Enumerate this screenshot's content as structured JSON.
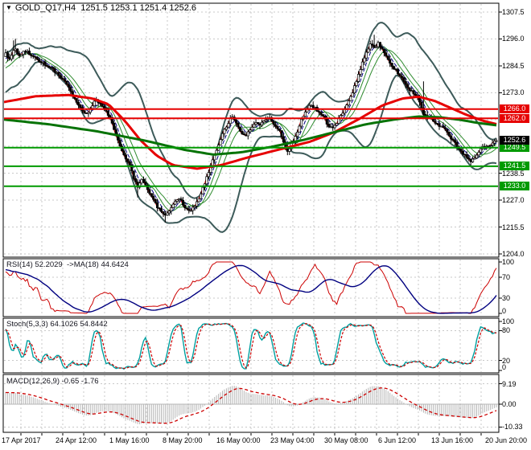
{
  "title": {
    "dropdown_icon": "▼",
    "symbol_timeframe": "GOLD_Q17,H4",
    "quote_line": "1251.5 1253.1 1251.4 1252.6"
  },
  "chart_data": {
    "type": "candlestick",
    "symbol": "GOLD_Q17",
    "timeframe": "H4",
    "ohlc": {
      "open": 1251.5,
      "high": 1253.1,
      "low": 1251.4,
      "close": 1252.6
    },
    "price_axis": {
      "min": 1204.0,
      "max": 1307.5,
      "ticks": [
        {
          "v": 1307.5,
          "label": "1307.5"
        },
        {
          "v": 1296.0,
          "label": "1296.0"
        },
        {
          "v": 1284.5,
          "label": "1284.5"
        },
        {
          "v": 1273.0,
          "label": "1273.0"
        },
        {
          "v": 1261.5,
          "label": ""
        },
        {
          "v": 1250.0,
          "label": ""
        },
        {
          "v": 1238.5,
          "label": "1238.5"
        },
        {
          "v": 1227.0,
          "label": "1227.0"
        },
        {
          "v": 1215.5,
          "label": "1215.5"
        },
        {
          "v": 1204.0,
          "label": "1204.0"
        }
      ]
    },
    "time_labels": [
      "17 Apr 2017",
      "24 Apr 12:00",
      "1 May 16:00",
      "8 May 20:00",
      "16 May 00:00",
      "23 May 04:00",
      "30 May 08:00",
      "6 Jun 12:00",
      "13 Jun 16:00",
      "20 Jun 20:00"
    ],
    "levels": [
      {
        "price": 1266.0,
        "label": "1266.0",
        "kind": "resistance"
      },
      {
        "price": 1262.0,
        "label": "1262.0",
        "kind": "resistance"
      },
      {
        "price": 1249.5,
        "label": "1249.5",
        "kind": "support"
      },
      {
        "price": 1241.5,
        "label": "1241.5",
        "kind": "support"
      },
      {
        "price": 1233.0,
        "label": "1233.0",
        "kind": "support"
      }
    ],
    "current": {
      "price": 1252.6,
      "label": "1252.6"
    },
    "close_path": [
      [
        6,
        1290
      ],
      [
        12,
        1287
      ],
      [
        18,
        1292
      ],
      [
        24,
        1289
      ],
      [
        32,
        1291
      ],
      [
        42,
        1288
      ],
      [
        52,
        1286
      ],
      [
        62,
        1284
      ],
      [
        72,
        1281
      ],
      [
        82,
        1277.5
      ],
      [
        92,
        1271
      ],
      [
        100,
        1267
      ],
      [
        106,
        1263.5
      ],
      [
        112,
        1266
      ],
      [
        119,
        1270.5
      ],
      [
        125,
        1268
      ],
      [
        131,
        1266
      ],
      [
        137,
        1262
      ],
      [
        143,
        1256
      ],
      [
        149,
        1250.5
      ],
      [
        155,
        1246
      ],
      [
        161,
        1242
      ],
      [
        167,
        1236
      ],
      [
        171,
        1232.5
      ],
      [
        176,
        1236.5
      ],
      [
        181,
        1233
      ],
      [
        187,
        1229
      ],
      [
        193,
        1225.5
      ],
      [
        199,
        1222.5
      ],
      [
        205,
        1220.5
      ],
      [
        211,
        1222.5
      ],
      [
        217,
        1226
      ],
      [
        223,
        1227.5
      ],
      [
        229,
        1224.5
      ],
      [
        235,
        1222
      ],
      [
        241,
        1224
      ],
      [
        247,
        1228
      ],
      [
        253,
        1233
      ],
      [
        259,
        1239
      ],
      [
        265,
        1245
      ],
      [
        271,
        1250.5
      ],
      [
        277,
        1255.5
      ],
      [
        283,
        1259.5
      ],
      [
        288,
        1263
      ],
      [
        293,
        1260
      ],
      [
        299,
        1256.5
      ],
      [
        305,
        1254
      ],
      [
        311,
        1257.5
      ],
      [
        317,
        1260.5
      ],
      [
        323,
        1259.5
      ],
      [
        329,
        1261
      ],
      [
        335,
        1262
      ],
      [
        341,
        1259.5
      ],
      [
        347,
        1257
      ],
      [
        353,
        1251
      ],
      [
        357,
        1247.5
      ],
      [
        362,
        1251
      ],
      [
        368,
        1255
      ],
      [
        374,
        1261
      ],
      [
        380,
        1265.5
      ],
      [
        386,
        1268
      ],
      [
        391,
        1266.5
      ],
      [
        397,
        1264.5
      ],
      [
        403,
        1262
      ],
      [
        409,
        1258.5
      ],
      [
        414,
        1257.5
      ],
      [
        420,
        1261
      ],
      [
        426,
        1264.5
      ],
      [
        432,
        1268.5
      ],
      [
        438,
        1273
      ],
      [
        444,
        1279
      ],
      [
        450,
        1285.5
      ],
      [
        456,
        1290.5
      ],
      [
        461,
        1294
      ],
      [
        466,
        1291.5
      ],
      [
        470,
        1294.5
      ],
      [
        474,
        1292
      ],
      [
        479,
        1289
      ],
      [
        485,
        1285.5
      ],
      [
        491,
        1283
      ],
      [
        497,
        1280
      ],
      [
        503,
        1277.5
      ],
      [
        509,
        1274.5
      ],
      [
        515,
        1272
      ],
      [
        521,
        1269.5
      ],
      [
        527,
        1263
      ],
      [
        532,
        1262.5
      ],
      [
        538,
        1261
      ],
      [
        544,
        1259.5
      ],
      [
        550,
        1258
      ],
      [
        556,
        1256
      ],
      [
        562,
        1253
      ],
      [
        568,
        1250
      ],
      [
        574,
        1247.5
      ],
      [
        580,
        1245.5
      ],
      [
        586,
        1243.5
      ],
      [
        591,
        1246
      ],
      [
        596,
        1248.5
      ],
      [
        601,
        1250.5
      ],
      [
        606,
        1249.5
      ],
      [
        611,
        1251
      ],
      [
        616,
        1252.6
      ]
    ],
    "wick_spikes": [
      [
        18,
        3,
        0
      ],
      [
        171,
        0,
        4
      ],
      [
        205,
        0,
        3
      ],
      [
        465,
        3.5,
        0
      ],
      [
        527,
        10,
        0
      ]
    ],
    "ma_red_path": [
      [
        5,
        1269
      ],
      [
        45,
        1271.5
      ],
      [
        85,
        1272
      ],
      [
        115,
        1270.5
      ],
      [
        135,
        1268
      ],
      [
        155,
        1261
      ],
      [
        175,
        1252.5
      ],
      [
        195,
        1246
      ],
      [
        215,
        1242
      ],
      [
        245,
        1240.5
      ],
      [
        275,
        1242
      ],
      [
        305,
        1245
      ],
      [
        345,
        1248.5
      ],
      [
        385,
        1252
      ],
      [
        415,
        1256
      ],
      [
        445,
        1261.5
      ],
      [
        475,
        1267.5
      ],
      [
        500,
        1270.5
      ],
      [
        520,
        1271.3
      ],
      [
        540,
        1269.5
      ],
      [
        560,
        1266.5
      ],
      [
        580,
        1263.5
      ],
      [
        600,
        1261
      ],
      [
        618,
        1259.5
      ]
    ],
    "ma_green_path": [
      [
        5,
        1261.5
      ],
      [
        60,
        1259.5
      ],
      [
        120,
        1256.5
      ],
      [
        180,
        1252.5
      ],
      [
        230,
        1248.5
      ],
      [
        265,
        1246.5
      ],
      [
        300,
        1247.5
      ],
      [
        340,
        1250
      ],
      [
        380,
        1253
      ],
      [
        420,
        1256.5
      ],
      [
        455,
        1259.5
      ],
      [
        490,
        1261.5
      ],
      [
        520,
        1262.8
      ],
      [
        545,
        1262.5
      ],
      [
        570,
        1261.5
      ],
      [
        595,
        1260
      ],
      [
        618,
        1259
      ]
    ],
    "panels": {
      "rsi": {
        "label": "RSI(14) 52.2029  ->MA(18) 44.6424",
        "period": 14,
        "value": 52.2029,
        "ma_period": 18,
        "ma_value": 44.6424,
        "range": [
          0,
          100
        ],
        "dash_levels": [
          70,
          30
        ],
        "ticks": [
          {
            "v": 100,
            "label": "100"
          },
          {
            "v": 70,
            "label": "70"
          },
          {
            "v": 30,
            "label": "30"
          },
          {
            "v": 0,
            "label": "0"
          }
        ]
      },
      "stoch": {
        "label": "Stoch(5,3,3) 64.1026 54.8442",
        "value_k": 64.1026,
        "value_d": 54.8442,
        "range": [
          0,
          100
        ],
        "dash_levels": [
          80,
          20
        ],
        "ticks": [
          {
            "v": 100,
            "label": "100"
          },
          {
            "v": 80,
            "label": "80"
          },
          {
            "v": 20,
            "label": "20"
          },
          {
            "v": 0,
            "label": "0"
          }
        ]
      },
      "macd": {
        "label": "MACD(12,26,9) -0.65 -1.76",
        "value": -0.65,
        "signal": -1.76,
        "ticks": [
          {
            "v": 9.19,
            "label": "9.19"
          },
          {
            "v": 0,
            "label": "0.00"
          },
          {
            "v": -10.33,
            "label": "-10.33"
          }
        ]
      }
    },
    "colors": {
      "bb": "#3d5b5a",
      "ma_fast_red": "#e60000",
      "ma_slow_green": "#067306",
      "thin_red": "#dd0000",
      "thin_blue": "#000080",
      "thin_green": "#2e8b2e",
      "grid": "#c9c9c9",
      "candle": "#000000",
      "rsi_line": "#cc0000",
      "rsi_ma": "#000080",
      "stoch_k": "#00a0a0",
      "stoch_d": "#cc0000",
      "macd_hist": "#b6b6b6",
      "macd_signal": "#cc0000",
      "level_red": "#e60000",
      "level_green": "#009a00",
      "current_badge": "#000000"
    }
  }
}
